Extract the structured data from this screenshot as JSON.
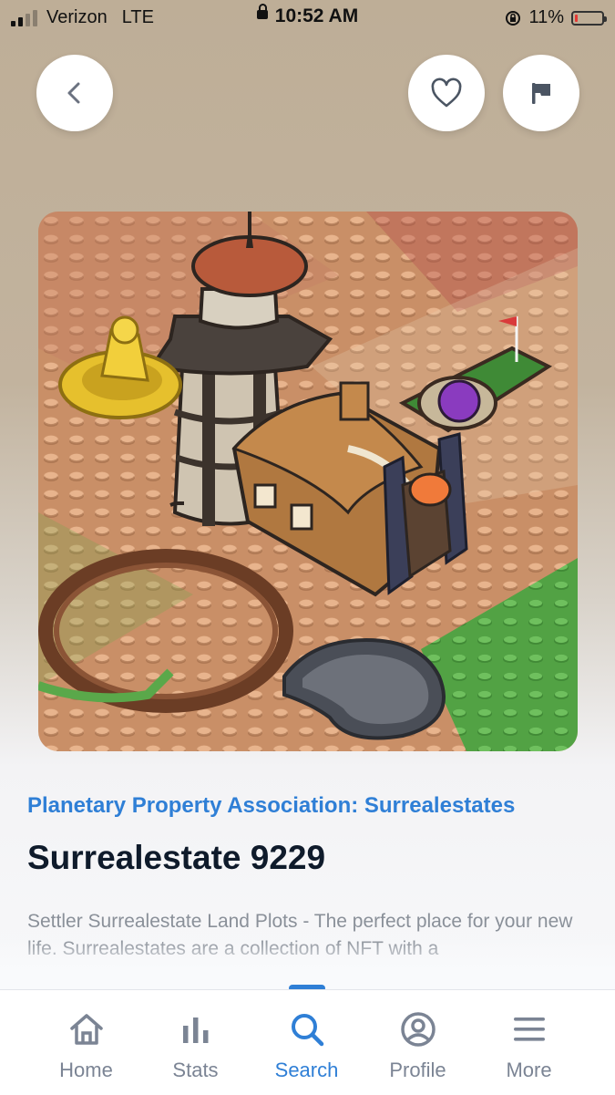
{
  "status_bar": {
    "carrier": "Verizon",
    "network": "LTE",
    "time": "10:52 AM",
    "battery": "11%",
    "battery_level": 0.11,
    "battery_color": "#e53935"
  },
  "header": {
    "back_icon": "chevron-left-icon",
    "favorite_icon": "heart-icon",
    "report_icon": "flag-icon"
  },
  "nft": {
    "collection": "Planetary Property Association: Surrealestates",
    "title": "Surrealestate 9229",
    "description": "Settler Surrealestate Land Plots - The perfect place for your new life. Surrealestates are a collection of NFT with a"
  },
  "tabbar": {
    "tabs": [
      {
        "label": "Home",
        "icon": "home-icon"
      },
      {
        "label": "Stats",
        "icon": "stats-icon"
      },
      {
        "label": "Search",
        "icon": "search-icon",
        "active": true
      },
      {
        "label": "Profile",
        "icon": "profile-icon"
      },
      {
        "label": "More",
        "icon": "menu-icon"
      }
    ]
  },
  "colors": {
    "accent": "#2f7fd6",
    "title": "#0f1b2b",
    "inactive_tab": "#7b8494"
  }
}
